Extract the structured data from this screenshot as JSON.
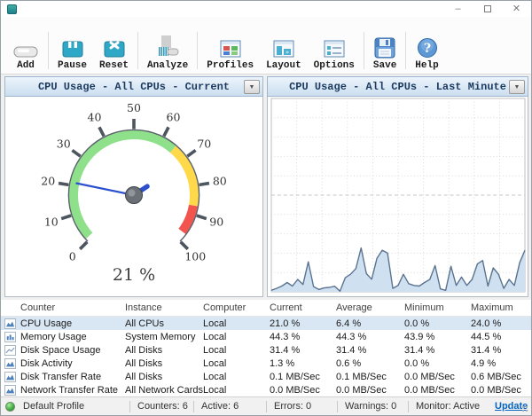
{
  "titlebar": {
    "controls": {
      "minimize": "–",
      "close": "✕"
    }
  },
  "toolbar": {
    "buttons": [
      {
        "icon": "add-icon",
        "label": "Add"
      },
      {
        "icon": "pause-icon",
        "label": "Pause"
      },
      {
        "icon": "reset-icon",
        "label": "Reset"
      },
      {
        "icon": "analyze-icon",
        "label": "Analyze"
      },
      {
        "icon": "profiles-icon",
        "label": "Profiles"
      },
      {
        "icon": "layout-icon",
        "label": "Layout"
      },
      {
        "icon": "options-icon",
        "label": "Options"
      },
      {
        "icon": "save-icon",
        "label": "Save"
      },
      {
        "icon": "help-icon",
        "label": "Help"
      }
    ]
  },
  "panels": {
    "left": {
      "title": "CPU Usage - All CPUs - Current"
    },
    "right": {
      "title": "CPU Usage - All CPUs - Last Minute"
    }
  },
  "chart_data": [
    {
      "type": "gauge",
      "title": "CPU Usage - All CPUs - Current",
      "value": 21,
      "unit": "%",
      "value_label": "21 %",
      "min": 0,
      "max": 100,
      "tick_interval": 10,
      "tick_labels": [
        "0",
        "10",
        "20",
        "30",
        "40",
        "50",
        "60",
        "70",
        "80",
        "90",
        "100"
      ],
      "sweep_deg": 270,
      "start_deg": 135,
      "zones": [
        {
          "from": 1,
          "to": 65,
          "color": "#8ee08a"
        },
        {
          "from": 65,
          "to": 87,
          "color": "#ffd94a"
        },
        {
          "from": 87,
          "to": 97,
          "color": "#f2544e"
        }
      ],
      "needle_color": "#2d50cc",
      "tick_color": "#4d555e"
    },
    {
      "type": "area",
      "title": "CPU Usage - All CPUs - Last Minute",
      "xlabel": "",
      "ylabel": "",
      "ylim": [
        0,
        100
      ],
      "grid": true,
      "line_color": "#5a7391",
      "fill_color": "#cfe0f1",
      "values": [
        0.8,
        1.8,
        3,
        4.8,
        3,
        6.4,
        3.8,
        15.5,
        2.7,
        1.2,
        2,
        2.3,
        2.9,
        0.3,
        7.3,
        9.1,
        12,
        22.7,
        9.4,
        6.5,
        17.4,
        21.5,
        20,
        1.8,
        3.3,
        9.1,
        4.2,
        3.3,
        3,
        4.8,
        6.4,
        13.6,
        1.5,
        0.8,
        13.2,
        3.3,
        7.6,
        3.3,
        6.4,
        14.4,
        16.2,
        3,
        12.4,
        9.1,
        1.8,
        6.4,
        3.3,
        15,
        21.5
      ]
    }
  ],
  "table": {
    "columns": [
      "Counter",
      "Instance",
      "Computer",
      "Current",
      "Average",
      "Minimum",
      "Maximum"
    ],
    "selected_index": 0,
    "rows": [
      {
        "icon": "area-chart-icon",
        "counter": "CPU Usage",
        "instance": "All CPUs",
        "computer": "Local",
        "current": "21.0 %",
        "average": "6.4 %",
        "minimum": "0.0 %",
        "maximum": "24.0 %"
      },
      {
        "icon": "bar-chart-icon",
        "counter": "Memory Usage",
        "instance": "System Memory",
        "computer": "Local",
        "current": "44.3 %",
        "average": "44.3 %",
        "minimum": "43.9 %",
        "maximum": "44.5 %"
      },
      {
        "icon": "line-chart-icon",
        "counter": "Disk Space Usage",
        "instance": "All Disks",
        "computer": "Local",
        "current": "31.4 %",
        "average": "31.4 %",
        "minimum": "31.4 %",
        "maximum": "31.4 %"
      },
      {
        "icon": "area-chart-icon",
        "counter": "Disk Activity",
        "instance": "All Disks",
        "computer": "Local",
        "current": "1.3 %",
        "average": "0.6 %",
        "minimum": "0.0 %",
        "maximum": "4.9 %"
      },
      {
        "icon": "area-chart-icon",
        "counter": "Disk Transfer Rate",
        "instance": "All Disks",
        "computer": "Local",
        "current": "0.1 MB/Sec",
        "average": "0.1 MB/Sec",
        "minimum": "0.0 MB/Sec",
        "maximum": "0.6 MB/Sec"
      },
      {
        "icon": "area-chart-icon",
        "counter": "Network Transfer Rate",
        "instance": "All Network Cards",
        "computer": "Local",
        "current": "0.0 MB/Sec",
        "average": "0.0 MB/Sec",
        "minimum": "0.0 MB/Sec",
        "maximum": "0.0 MB/Sec"
      }
    ]
  },
  "statusbar": {
    "led": "green",
    "profile": "Default Profile",
    "counters": "Counters: 6",
    "active": "Active: 6",
    "errors": "Errors: 0",
    "warnings": "Warnings: 0",
    "monitor": "Monitor: Active",
    "update_link": "Update"
  }
}
